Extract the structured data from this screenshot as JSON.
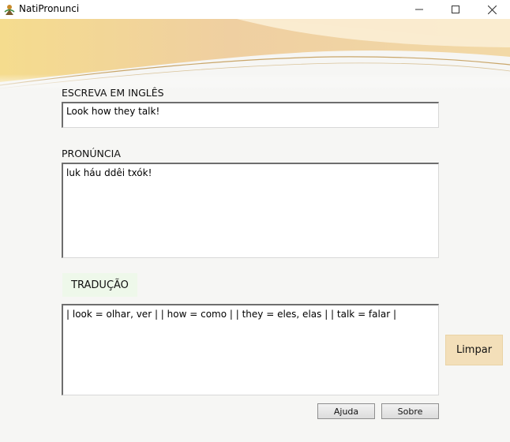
{
  "window": {
    "title": "NatiPronunci"
  },
  "labels": {
    "english": "ESCREVA EM INGLÊS",
    "pronunciation": "PRONÚNCIA",
    "translation": "TRADUÇÃO"
  },
  "fields": {
    "english_value": "Look how they talk!",
    "pronunciation_value": "luk háu ddêi txók!",
    "translation_value": "| look = olhar, ver | | how = como | | they = eles, elas | | talk = falar |"
  },
  "buttons": {
    "clear": "Limpar",
    "help": "Ajuda",
    "about": "Sobre"
  },
  "colors": {
    "header_gold": "#f3d79a",
    "clear_button": "#f3dfb9",
    "translation_label_bg": "#eef8ea"
  }
}
